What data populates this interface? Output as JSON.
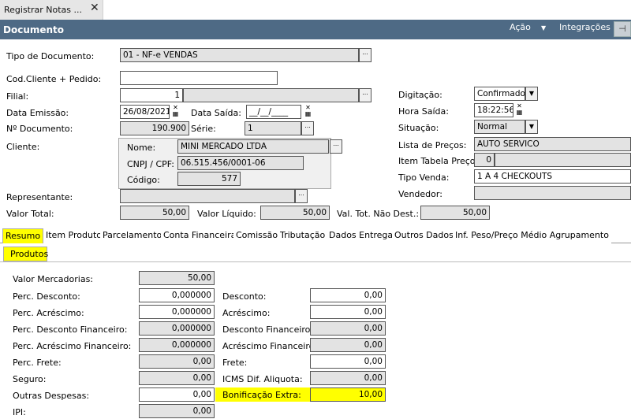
{
  "window_tab": {
    "title": "Registrar Notas ...",
    "close": "✕"
  },
  "header": {
    "title": "Documento",
    "acao": "Ação",
    "acao_arrow": "▼",
    "integracoes": "Integrações",
    "pin": "⊣"
  },
  "form": {
    "tipo_documento": {
      "label": "Tipo de Documento:",
      "value": "01 - NF-e VENDAS"
    },
    "cod_cliente": {
      "label": "Cod.Cliente + Pedido:",
      "value": ""
    },
    "filial": {
      "label": "Filial:",
      "value": "1",
      "name": ""
    },
    "data_emissao": {
      "label": "Data Emissão:",
      "value": "26/08/2021"
    },
    "data_saida": {
      "label": "Data Saída:",
      "value": "__/__/____"
    },
    "num_documento": {
      "label": "Nº Documento:",
      "value": "190.900"
    },
    "serie": {
      "label": "Série:",
      "value": "1"
    },
    "cliente": {
      "label": "Cliente:",
      "nome_label": "Nome:",
      "nome": "MINI MERCADO LTDA",
      "cnpj_label": "CNPJ / CPF:",
      "cnpj": "06.515.456/0001-06",
      "codigo_label": "Código:",
      "codigo": "577"
    },
    "representante": {
      "label": "Representante:",
      "value": ""
    },
    "valor_total": {
      "label": "Valor Total:",
      "value": "50,00"
    },
    "valor_liquido": {
      "label": "Valor Líquido:",
      "value": "50,00"
    },
    "val_nao_dest": {
      "label": "Val. Tot. Não Dest.:",
      "value": "50,00"
    },
    "digitacao": {
      "label": "Digitação:",
      "value": "Confirmado"
    },
    "hora_saida": {
      "label": "Hora Saída:",
      "value": "18:22:56"
    },
    "situacao": {
      "label": "Situação:",
      "value": "Normal"
    },
    "lista_precos": {
      "label": "Lista de Preços:",
      "value": "AUTO SERVICO"
    },
    "item_tabela": {
      "label": "Item Tabela Preço:",
      "value": "0"
    },
    "tipo_venda": {
      "label": "Tipo Venda:",
      "value": "1 A 4 CHECKOUTS"
    },
    "vendedor": {
      "label": "Vendedor:",
      "value": ""
    }
  },
  "tabs": [
    "Resumo",
    "Item Produto",
    "Parcelamento",
    "Conta Financeira",
    "Comissão",
    "Tributação",
    "Dados Entrega",
    "Outros Dados",
    "Inf. Peso/Preço Médio Agrupamento"
  ],
  "subtab": "Produtos",
  "resumo": {
    "valor_mercadorias": {
      "label": "Valor Mercadorias:",
      "value": "50,00"
    },
    "perc_desconto": {
      "label": "Perc. Desconto:",
      "value": "0,000000"
    },
    "perc_acrescimo": {
      "label": "Perc. Acréscimo:",
      "value": "0,000000"
    },
    "perc_desc_fin": {
      "label": "Perc. Desconto Financeiro:",
      "value": "0,000000"
    },
    "perc_acr_fin": {
      "label": "Perc. Acréscimo Financeiro:",
      "value": "0,000000"
    },
    "perc_frete": {
      "label": "Perc. Frete:",
      "value": "0,00"
    },
    "seguro": {
      "label": "Seguro:",
      "value": "0,00"
    },
    "outras_despesas": {
      "label": "Outras Despesas:",
      "value": "0,00"
    },
    "ipi": {
      "label": "IPI:",
      "value": "0,00"
    },
    "desconto": {
      "label": "Desconto:",
      "value": "0,00"
    },
    "acrescimo": {
      "label": "Acréscimo:",
      "value": "0,00"
    },
    "desc_fin": {
      "label": "Desconto Financeiro:",
      "value": "0,00"
    },
    "acr_fin": {
      "label": "Acréscimo Financeiro:",
      "value": "0,00"
    },
    "frete": {
      "label": "Frete:",
      "value": "0,00"
    },
    "icms_dif": {
      "label": "ICMS Dif. Aliquota:",
      "value": "0,00"
    },
    "bonificacao": {
      "label": "Bonificação Extra:",
      "value": "10,00"
    }
  },
  "icons": {
    "ellipsis": "...",
    "dropdown": "▼",
    "calendar": "▦"
  }
}
